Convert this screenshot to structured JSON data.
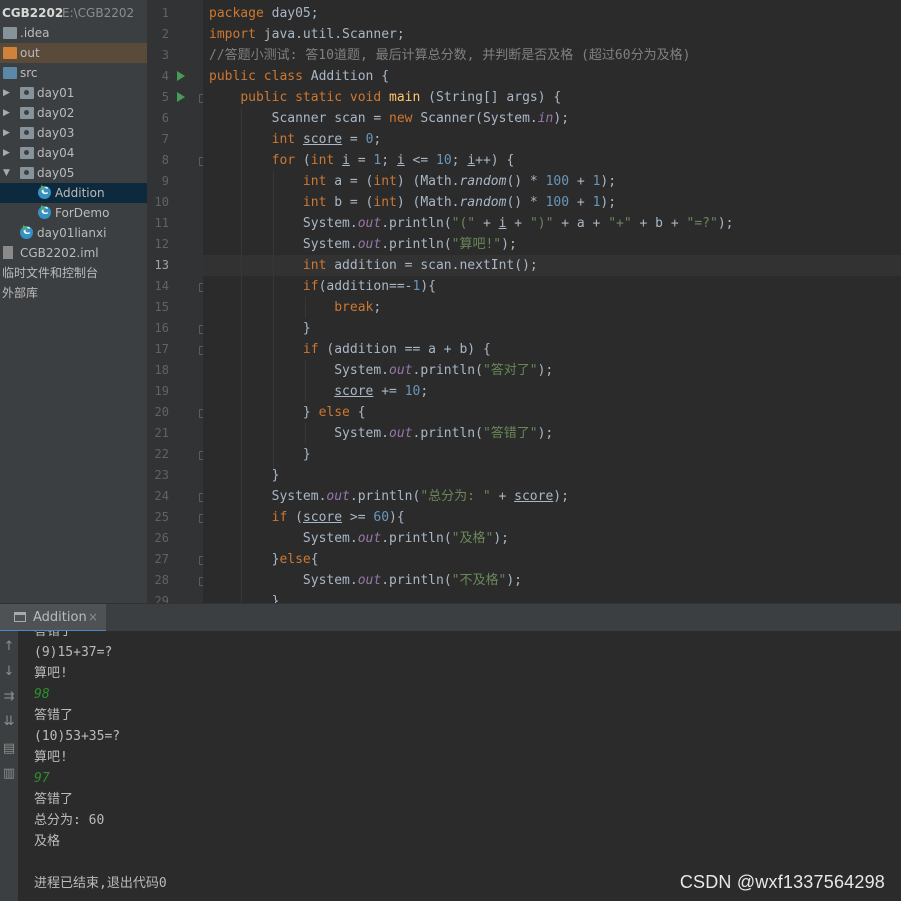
{
  "project": {
    "name": "CGB2202",
    "path": "E:\\CGB2202",
    "tree": [
      {
        "label": ".idea",
        "icon": "folder-icon",
        "depth": 0,
        "arrow": "",
        "style": "gray"
      },
      {
        "label": "out",
        "icon": "folder-icon",
        "depth": 0,
        "arrow": "",
        "style": "orange"
      },
      {
        "label": "src",
        "icon": "folder-icon",
        "depth": 0,
        "arrow": "",
        "style": "blue"
      },
      {
        "label": "day01",
        "icon": "package-icon",
        "depth": 0,
        "arrow": "▶",
        "style": "pkg"
      },
      {
        "label": "day02",
        "icon": "package-icon",
        "depth": 0,
        "arrow": "▶",
        "style": "pkg"
      },
      {
        "label": "day03",
        "icon": "package-icon",
        "depth": 0,
        "arrow": "▶",
        "style": "pkg"
      },
      {
        "label": "day04",
        "icon": "package-icon",
        "depth": 0,
        "arrow": "▶",
        "style": "pkg"
      },
      {
        "label": "day05",
        "icon": "package-icon",
        "depth": 0,
        "arrow": "▼",
        "style": "pkg"
      },
      {
        "label": "Addition",
        "icon": "java-class-icon",
        "depth": 2,
        "arrow": "",
        "style": "class"
      },
      {
        "label": "ForDemo",
        "icon": "java-class-icon",
        "depth": 2,
        "arrow": "",
        "style": "class"
      },
      {
        "label": "day01lianxi",
        "icon": "java-class-icon",
        "depth": 1,
        "arrow": "",
        "style": "class"
      },
      {
        "label": "CGB2202.iml",
        "icon": "iml-file-icon",
        "depth": 0,
        "arrow": "",
        "style": "iml"
      },
      {
        "label": "临时文件和控制台",
        "icon": "",
        "depth": -1,
        "arrow": "",
        "style": "text"
      },
      {
        "label": "外部库",
        "icon": "",
        "depth": -1,
        "arrow": "",
        "style": "text"
      }
    ]
  },
  "editor": {
    "current_line": 13,
    "lines": [
      "<span class=\"kw\">package</span> day05;",
      "<span class=\"kw\">import</span> java.util.Scanner;",
      "<span class=\"cmt\">//答题小测试: 答10道题, 最后计算总分数, 并判断是否及格 (超过60分为及格)</span>",
      "<span class=\"kw\">public class</span> Addition {",
      "    <span class=\"kw\">public static void</span> <span class=\"mth\">main</span> (String[] args) {",
      "        Scanner scan = <span class=\"kw\">new</span> Scanner(System.<span class=\"fld\">in</span>);",
      "        <span class=\"kw\">int</span> <span class=\"var\">score</span> = <span class=\"num\">0</span>;",
      "        <span class=\"kw\">for</span> (<span class=\"kw\">int</span> <span class=\"var\">i</span> = <span class=\"num\">1</span>; <span class=\"var\">i</span> &lt;= <span class=\"num\">10</span>; <span class=\"var\">i</span>++) {",
      "            <span class=\"kw\">int</span> a = (<span class=\"kw\">int</span>) (Math.<span class=\"ital\">random</span>() * <span class=\"num\">100</span> + <span class=\"num\">1</span>);",
      "            <span class=\"kw\">int</span> b = (<span class=\"kw\">int</span>) (Math.<span class=\"ital\">random</span>() * <span class=\"num\">100</span> + <span class=\"num\">1</span>);",
      "            System.<span class=\"fld\">out</span>.println(<span class=\"str\">\"(\"</span> + <span class=\"var\">i</span> + <span class=\"str\">\")\"</span> + a + <span class=\"str\">\"+\"</span> + b + <span class=\"str\">\"=?\"</span>);",
      "            System.<span class=\"fld\">out</span>.println(<span class=\"str\">\"算吧!\"</span>);",
      "            <span class=\"kw\">int</span> addition = scan.nextInt();",
      "            <span class=\"kw\">if</span>(addition==-<span class=\"num\">1</span>){",
      "                <span class=\"kw\">break</span>;",
      "            }",
      "            <span class=\"kw\">if</span> (addition == a + b) {",
      "                System.<span class=\"fld\">out</span>.println(<span class=\"str\">\"答对了\"</span>);",
      "                <span class=\"var\">score</span> += <span class=\"num\">10</span>;",
      "            } <span class=\"kw\">else</span> {",
      "                System.<span class=\"fld\">out</span>.println(<span class=\"str\">\"答错了\"</span>);",
      "            }",
      "        }",
      "        System.<span class=\"fld\">out</span>.println(<span class=\"str\">\"总分为: \"</span> + <span class=\"var\">score</span>);",
      "        <span class=\"kw\">if</span> (<span class=\"var\">score</span> &gt;= <span class=\"num\">60</span>){",
      "            System.<span class=\"fld\">out</span>.println(<span class=\"str\">\"及格\"</span>);",
      "        }<span class=\"kw\">else</span>{",
      "            System.<span class=\"fld\">out</span>.println(<span class=\"str\">\"不及格\"</span>);",
      "        }"
    ],
    "run_marker_lines": [
      4,
      5
    ],
    "fold_marker_lines": [
      5,
      8,
      14,
      16,
      17,
      20,
      22,
      24,
      25,
      27,
      28
    ]
  },
  "run_panel": {
    "tab_label": "Addition",
    "tab_close": "×",
    "toolbar_icons": [
      "up-arrow-icon",
      "down-arrow-icon",
      "soft-wrap-icon",
      "scroll-to-end-icon",
      "print-icon",
      "trash-icon"
    ],
    "output": [
      {
        "text": "答错了",
        "input": false
      },
      {
        "text": "(9)15+37=?",
        "input": false
      },
      {
        "text": "算吧!",
        "input": false
      },
      {
        "text": "98",
        "input": true
      },
      {
        "text": "答错了",
        "input": false
      },
      {
        "text": "(10)53+35=?",
        "input": false
      },
      {
        "text": "算吧!",
        "input": false
      },
      {
        "text": "97",
        "input": true
      },
      {
        "text": "答错了",
        "input": false
      },
      {
        "text": "总分为: 60",
        "input": false
      },
      {
        "text": "及格",
        "input": false
      },
      {
        "text": "",
        "input": false
      },
      {
        "text": "进程已结束,退出代码0",
        "input": false
      }
    ]
  },
  "watermark": "CSDN @wxf1337564298",
  "colors": {
    "keyword": "#cc7832",
    "number": "#6897bb",
    "string": "#6a8759",
    "comment": "#808080",
    "field": "#9876aa",
    "method": "#ffc66d",
    "user_input": "#2e8f2e"
  }
}
